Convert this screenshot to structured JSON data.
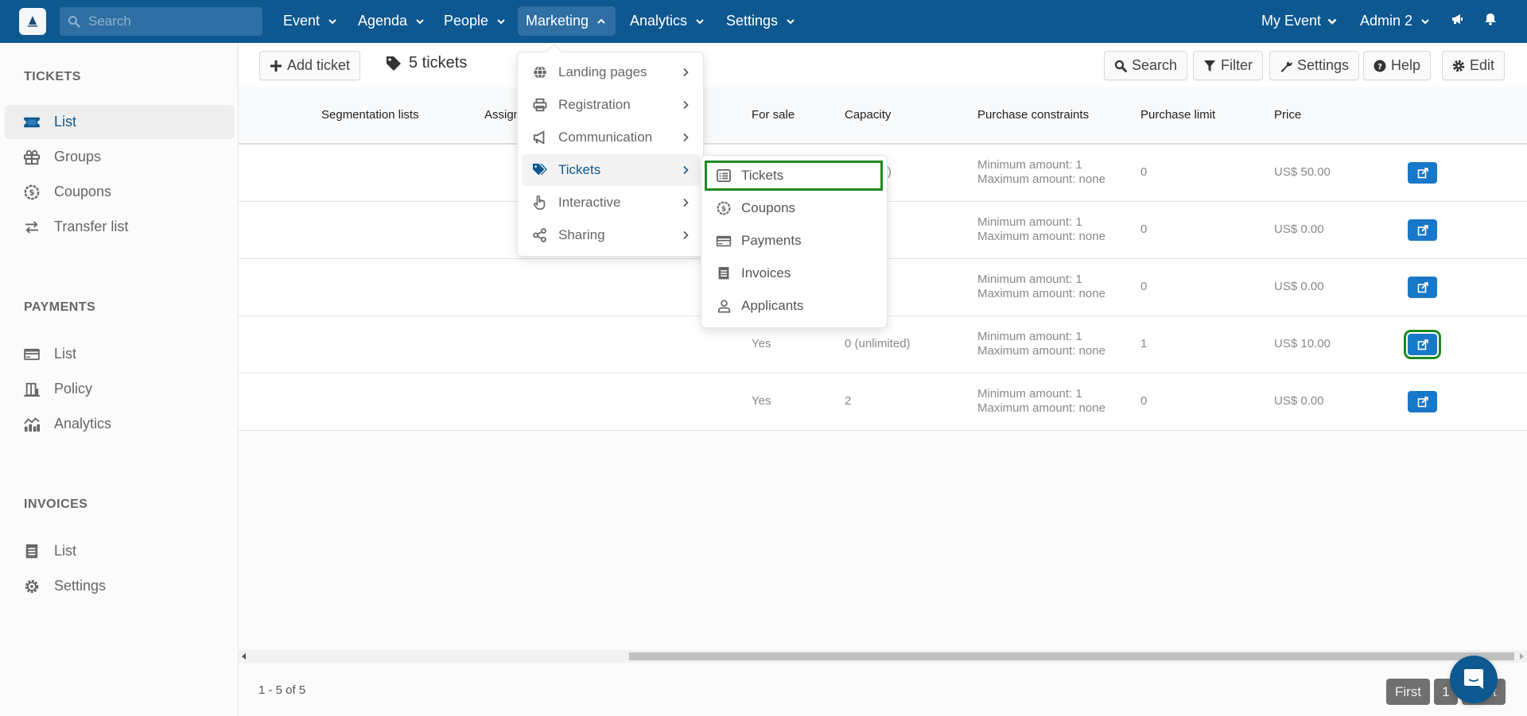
{
  "topbar": {
    "search_placeholder": "Search",
    "nav": [
      {
        "label": "Event",
        "active": false
      },
      {
        "label": "Agenda",
        "active": false
      },
      {
        "label": "People",
        "active": false
      },
      {
        "label": "Marketing",
        "active": true
      },
      {
        "label": "Analytics",
        "active": false
      },
      {
        "label": "Settings",
        "active": false
      }
    ],
    "event_selector": "My Event",
    "user_menu": "Admin 2",
    "icons": [
      "bullhorn-icon",
      "bell-icon"
    ]
  },
  "sidebar": {
    "sections": [
      {
        "title": "TICKETS",
        "items": [
          {
            "label": "List",
            "icon": "ticket-icon",
            "active": true
          },
          {
            "label": "Groups",
            "icon": "gift-icon",
            "active": false
          },
          {
            "label": "Coupons",
            "icon": "coupon-icon",
            "active": false
          },
          {
            "label": "Transfer list",
            "icon": "transfer-icon",
            "active": false
          }
        ]
      },
      {
        "title": "PAYMENTS",
        "items": [
          {
            "label": "List",
            "icon": "credit-card-icon",
            "active": false
          },
          {
            "label": "Policy",
            "icon": "building-icon",
            "active": false
          },
          {
            "label": "Analytics",
            "icon": "chart-icon",
            "active": false
          }
        ]
      },
      {
        "title": "INVOICES",
        "items": [
          {
            "label": "List",
            "icon": "receipt-icon",
            "active": false
          },
          {
            "label": "Settings",
            "icon": "gear-icon",
            "active": false
          }
        ]
      }
    ]
  },
  "toolbar": {
    "add_ticket": "Add ticket",
    "ticket_count": "5 tickets",
    "search": "Search",
    "filter": "Filter",
    "settings": "Settings",
    "help": "Help",
    "edit": "Edit"
  },
  "table": {
    "columns": [
      "Segmentation lists",
      "Assigned",
      "For sale",
      "Capacity",
      "Purchase constraints",
      "Purchase limit",
      "Price"
    ],
    "column_visible_labels": [
      "Segmentation lists",
      "Assign",
      "For sale",
      "Capacity",
      "Purchase constraints",
      "Purchase limit",
      "Price"
    ],
    "rows": [
      {
        "for_sale": "",
        "capacity": "ted)",
        "constraints_min": "Minimum amount: 1",
        "constraints_max": "Maximum amount: none",
        "purchase_limit": "0",
        "price": "US$ 50.00"
      },
      {
        "for_sale": "",
        "capacity": "",
        "constraints_min": "Minimum amount: 1",
        "constraints_max": "Maximum amount: none",
        "purchase_limit": "0",
        "price": "US$ 0.00"
      },
      {
        "for_sale": "",
        "capacity": "",
        "constraints_min": "Minimum amount: 1",
        "constraints_max": "Maximum amount: none",
        "purchase_limit": "0",
        "price": "US$ 0.00"
      },
      {
        "for_sale": "Yes",
        "capacity": "0 (unlimited)",
        "constraints_min": "Minimum amount: 1",
        "constraints_max": "Maximum amount: none",
        "purchase_limit": "1",
        "price": "US$ 10.00"
      },
      {
        "for_sale": "Yes",
        "capacity": "2",
        "constraints_min": "Minimum amount: 1",
        "constraints_max": "Maximum amount: none",
        "purchase_limit": "0",
        "price": "US$ 0.00"
      }
    ]
  },
  "footer": {
    "range": "1 - 5 of 5",
    "pagination": {
      "first": "First",
      "page": "1",
      "last": "Last"
    }
  },
  "marketing_menu": {
    "items": [
      {
        "label": "Landing pages",
        "icon": "globe-icon",
        "active": false
      },
      {
        "label": "Registration",
        "icon": "printer-icon",
        "active": false
      },
      {
        "label": "Communication",
        "icon": "bullhorn-icon",
        "active": false
      },
      {
        "label": "Tickets",
        "icon": "tags-icon",
        "active": true
      },
      {
        "label": "Interactive",
        "icon": "hand-pointer-icon",
        "active": false
      },
      {
        "label": "Sharing",
        "icon": "share-icon",
        "active": false
      }
    ]
  },
  "tickets_submenu": {
    "items": [
      {
        "label": "Tickets",
        "icon": "list-icon",
        "highlighted": true
      },
      {
        "label": "Coupons",
        "icon": "coupon-icon",
        "highlighted": false
      },
      {
        "label": "Payments",
        "icon": "credit-card-icon",
        "highlighted": false
      },
      {
        "label": "Invoices",
        "icon": "receipt-icon",
        "highlighted": false
      },
      {
        "label": "Applicants",
        "icon": "user-icon",
        "highlighted": false
      }
    ]
  },
  "colors": {
    "brand": "#0d5891",
    "edit_button": "#1878c8",
    "highlight": "#1e8a1e"
  }
}
